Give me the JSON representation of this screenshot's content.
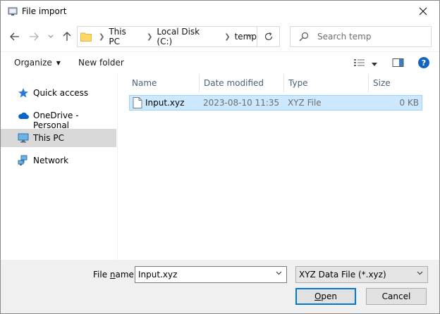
{
  "window": {
    "title": "File import"
  },
  "address": {
    "crumbs": [
      "This PC",
      "Local Disk (C:)",
      "temp"
    ]
  },
  "search": {
    "placeholder": "Search temp"
  },
  "toolbar": {
    "organize": "Organize",
    "new_folder": "New folder"
  },
  "nav": {
    "items": [
      {
        "label": "Quick access",
        "icon": "star-icon"
      },
      {
        "label": "OneDrive - Personal",
        "icon": "cloud-icon"
      },
      {
        "label": "This PC",
        "icon": "computer-icon",
        "selected": true
      },
      {
        "label": "Network",
        "icon": "network-icon"
      }
    ]
  },
  "columns": {
    "name": "Name",
    "date": "Date modified",
    "type": "Type",
    "size": "Size"
  },
  "files": [
    {
      "name": "Input.xyz",
      "date": "2023-08-10 11:35",
      "type": "XYZ File",
      "size": "0 KB"
    }
  ],
  "bottom": {
    "filename_label_pre": "File ",
    "filename_label_u": "n",
    "filename_label_post": "ame:",
    "filename_value": "Input.xyz",
    "filetype": "XYZ Data File (*.xyz)",
    "open_u": "O",
    "open_rest": "pen",
    "cancel": "Cancel"
  },
  "colors": {
    "accent": "#0078d7",
    "selection": "#cce8ff",
    "selection_border": "#99d1ff",
    "nav_selected": "#d9d9d9"
  }
}
